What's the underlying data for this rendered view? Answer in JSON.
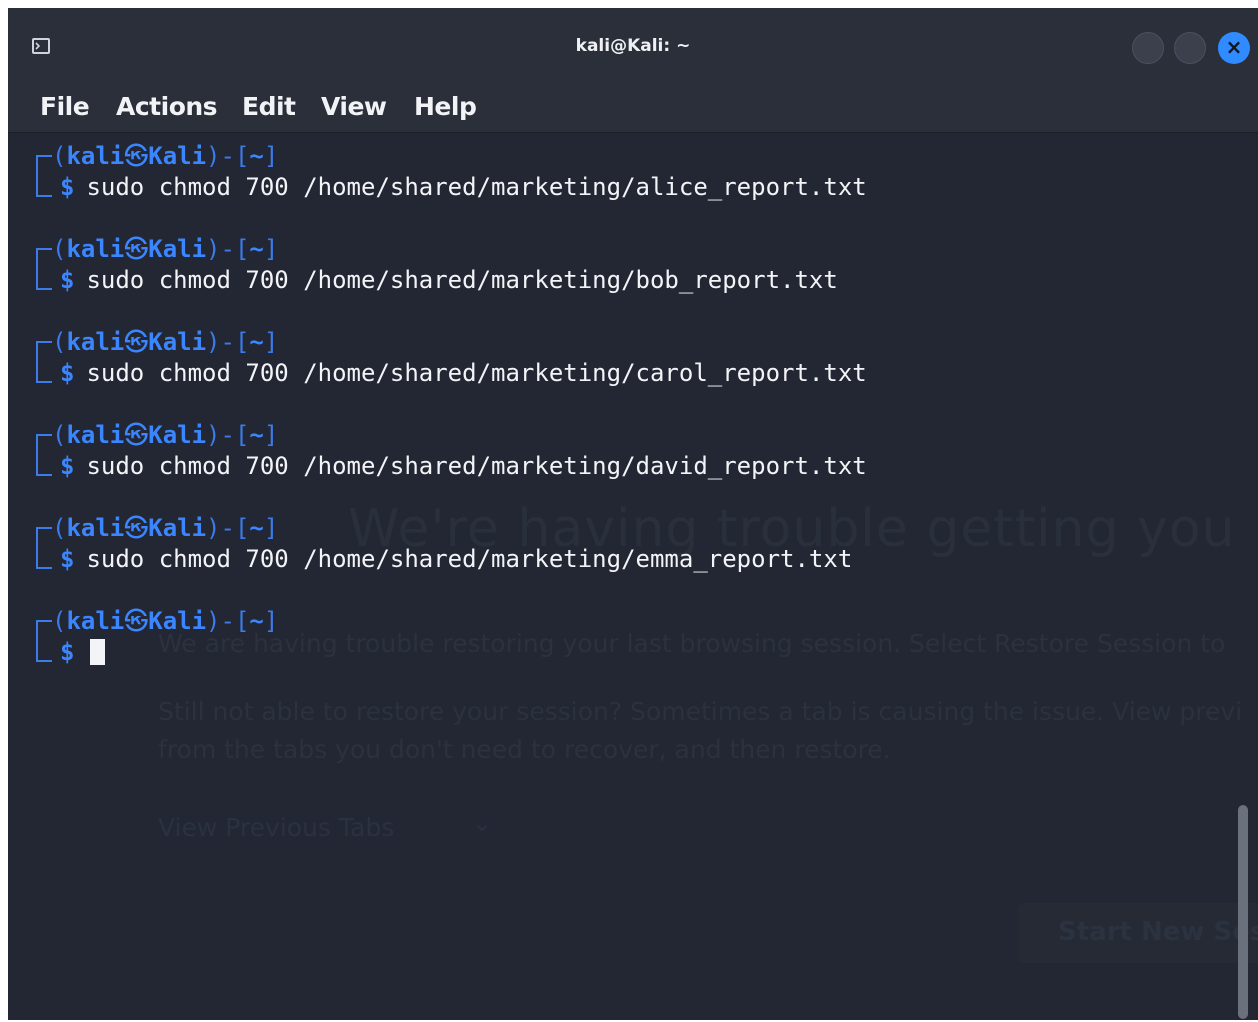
{
  "window": {
    "title": "kali@Kali: ~",
    "close_glyph": "×"
  },
  "menu": {
    "items": [
      "File",
      "Actions",
      "Edit",
      "View",
      "Help"
    ]
  },
  "prompt": {
    "open": "(",
    "user": "kali",
    "at_glyph": "㉿",
    "host": "Kali",
    "mid": ")-[",
    "path": "~",
    "close": "]",
    "dollar": "$"
  },
  "commands": [
    "sudo chmod 700 /home/shared/marketing/alice_report.txt",
    "sudo chmod 700 /home/shared/marketing/bob_report.txt",
    "sudo chmod 700 /home/shared/marketing/carol_report.txt",
    "sudo chmod 700 /home/shared/marketing/david_report.txt",
    "sudo chmod 700 /home/shared/marketing/emma_report.txt"
  ],
  "background_page": {
    "heading": "We're having trouble getting you",
    "body1": "We are having trouble restoring your last browsing session. Select Restore Session to",
    "body2": "Still not able to restore your session? Sometimes a tab is causing the issue. View previ",
    "body3": "from the tabs you don't need to recover, and then restore.",
    "link": "View Previous Tabs",
    "chevron": "⌄",
    "button": "Start New Ses"
  },
  "colors": {
    "terminal_bg": "#222733",
    "prompt_blue": "#3b86ff",
    "close_button": "#2f8bff"
  }
}
